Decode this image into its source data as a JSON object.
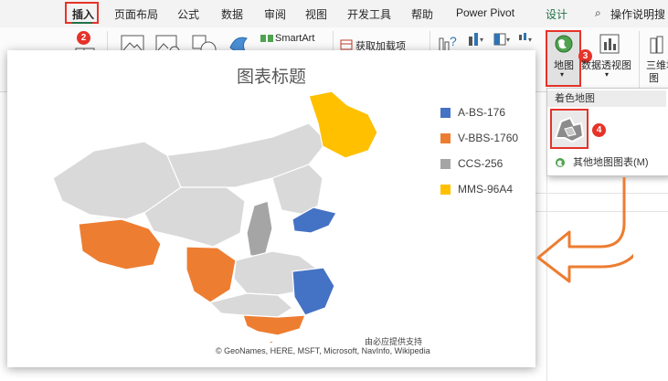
{
  "ribbon_tabs": [
    {
      "label": "插入",
      "active": true
    },
    {
      "label": "页面布局"
    },
    {
      "label": "公式"
    },
    {
      "label": "数据"
    },
    {
      "label": "审阅"
    },
    {
      "label": "视图"
    },
    {
      "label": "开发工具"
    },
    {
      "label": "帮助"
    },
    {
      "label": "Power Pivot"
    },
    {
      "label": "设计"
    }
  ],
  "tell_me": "操作说明搜",
  "ribbon": {
    "smartart_label": "SmartArt",
    "get_addins_label": "获取加载项",
    "map_label": "地图",
    "pivot_chart_label": "数据透视图",
    "three_d_label": "三维地",
    "three_d_label2": "图",
    "badges": {
      "insert": "2",
      "map": "3",
      "filled_map": "4"
    }
  },
  "dropdown": {
    "header": "着色地图",
    "other_maps": "其他地图图表(M)"
  },
  "chart": {
    "title": "图表标题",
    "attribution_line1": "由必应提供支持",
    "attribution_line2": "© GeoNames, HERE, MSFT, Microsoft, NavInfo, Wikipedia"
  },
  "chart_data": {
    "type": "map",
    "title": "图表标题",
    "series": [
      {
        "name": "A-BS-176",
        "color": "#4472c4"
      },
      {
        "name": "V-BBS-1760",
        "color": "#ed7d31"
      },
      {
        "name": "CCS-256",
        "color": "#a5a5a5"
      },
      {
        "name": "MMS-96A4",
        "color": "#ffc000"
      }
    ],
    "base_color": "#d9d9d9",
    "legend_position": "right"
  },
  "colors": {
    "accent_red": "#e63329",
    "excel_green": "#1e7145",
    "arrow": "#ed7d31"
  }
}
